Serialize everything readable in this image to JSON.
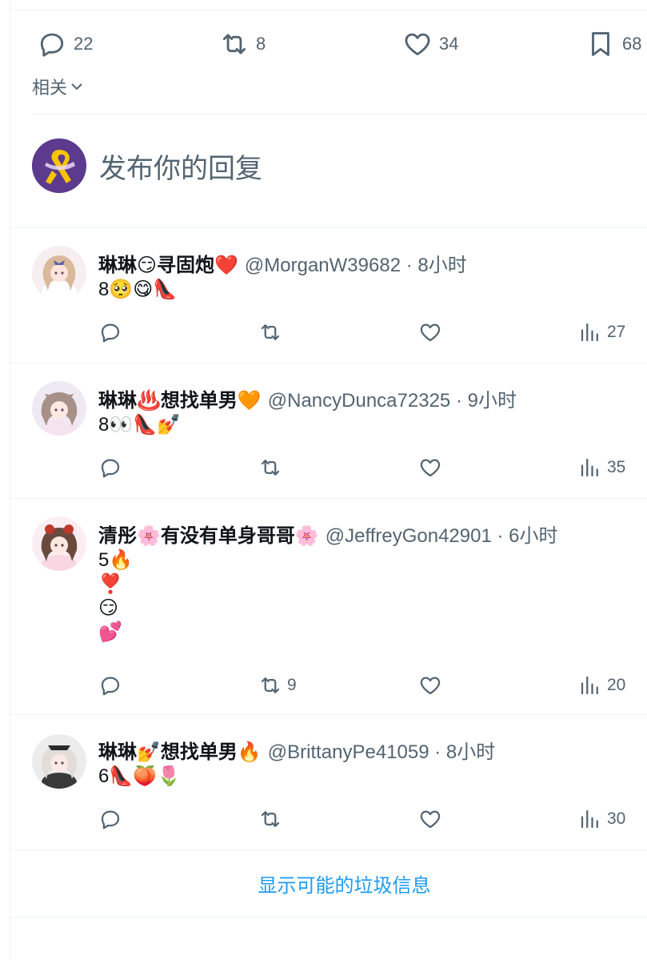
{
  "tweet_actions": {
    "replies": "22",
    "reposts": "8",
    "likes": "34",
    "bookmarks": "68"
  },
  "related_label": "相关",
  "composer": {
    "placeholder": "发布你的回复"
  },
  "replies": [
    {
      "name": "琳琳😏寻固炮❤️",
      "handle": "@MorganW39682 · 8小时",
      "text": "8🥺😋👠",
      "views": "27",
      "lines": [
        "8🥺😋👠"
      ]
    },
    {
      "name": "琳琳♨️想找单男🧡",
      "handle": "@NancyDunca72325 · 9小时",
      "text": "8👀👠💅",
      "views": "35",
      "lines": [
        "8👀👠💅"
      ]
    },
    {
      "name": "清彤🌸有没有单身哥哥🌸",
      "handle": "@JeffreyGon42901 · 6小时",
      "text": "5🔥\n❣️\n😏\n💕",
      "reposts": "9",
      "views": "20",
      "lines": [
        "5🔥",
        "❣️",
        "😏",
        "💕"
      ]
    },
    {
      "name": "琳琳💅想找单男🔥",
      "handle": "@BrittanyPe41059 · 8小时",
      "text": "6👠🍑🌷",
      "views": "30",
      "lines": [
        "6👠🍑🌷"
      ]
    }
  ],
  "spam_link": "显示可能的垃圾信息",
  "colors": {
    "text": "#0f1419",
    "muted": "#536471",
    "accent": "#1d9bf0",
    "border": "#eff3f4"
  }
}
